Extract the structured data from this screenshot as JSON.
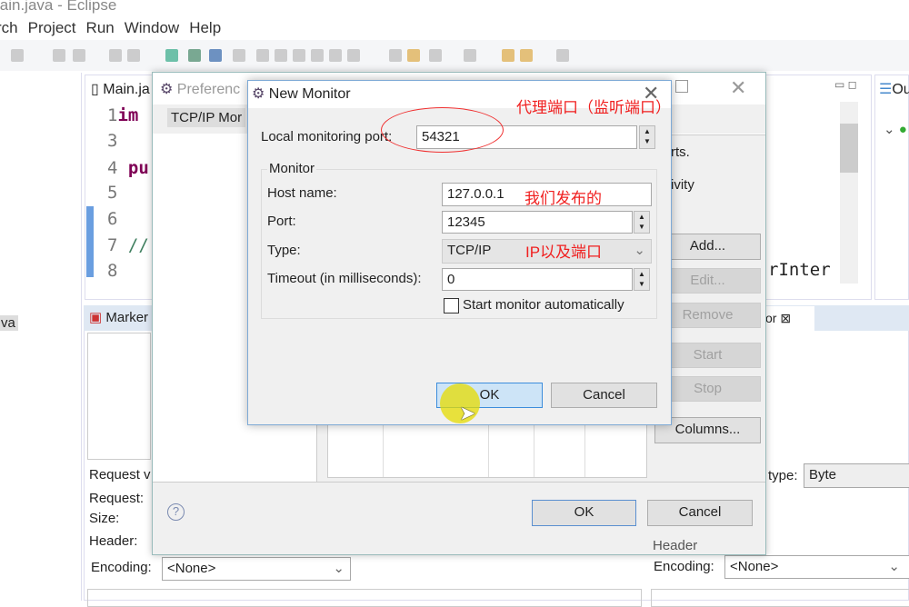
{
  "window": {
    "title": "lain.java - Eclipse"
  },
  "menu": [
    "rch",
    "Project",
    "Run",
    "Window",
    "Help"
  ],
  "left_panel": {
    "item": "va"
  },
  "editor": {
    "tab": "Main.ja",
    "lines": [
      {
        "n": "1",
        "code": "im"
      },
      {
        "n": "3",
        "code": ""
      },
      {
        "n": "4",
        "code": "pu"
      },
      {
        "n": "5",
        "code": ""
      },
      {
        "n": "6",
        "code": ""
      },
      {
        "n": "7",
        "code": "//"
      },
      {
        "n": "8",
        "code": ""
      }
    ],
    "fragment": "rInter"
  },
  "outline": {
    "tab": "Ou"
  },
  "bottom": {
    "markers_tab": "Marker",
    "monitor_tab": "or",
    "request_label": "Request v",
    "request": "Request:",
    "size": "Size:",
    "header": "Header:",
    "header_right": "Header",
    "encoding_label": "Encoding:",
    "encoding_value": "<None>",
    "encoding_label_right": "Encoding:",
    "encoding_value_right": "<None>",
    "type_label": "type:",
    "type_value": "Byte"
  },
  "preferences": {
    "title": "Preferenc",
    "tree_item": "TCP/IP Mor",
    "text1": "rts.",
    "text2": "ivity",
    "buttons": {
      "add": "Add...",
      "edit": "Edit...",
      "remove": "Remove",
      "start": "Start",
      "stop": "Stop",
      "columns": "Columns..."
    },
    "ok": "OK",
    "cancel": "Cancel"
  },
  "new_monitor": {
    "title": "New Monitor",
    "local_port_label": "Local monitoring port:",
    "local_port": "54321",
    "group": "Monitor",
    "host_label": "Host name:",
    "host": "127.0.0.1",
    "port_label": "Port:",
    "port": "12345",
    "type_label": "Type:",
    "type": "TCP/IP",
    "timeout_label": "Timeout (in milliseconds):",
    "timeout": "0",
    "auto_start": "Start monitor automatically",
    "auto_start_checked": false,
    "ok": "OK",
    "cancel": "Cancel"
  },
  "annotations": {
    "proxy_port": "代理端口（监听端口）",
    "published": "我们发布的",
    "ip_port": "IP以及端口",
    "color": "#f02020"
  }
}
